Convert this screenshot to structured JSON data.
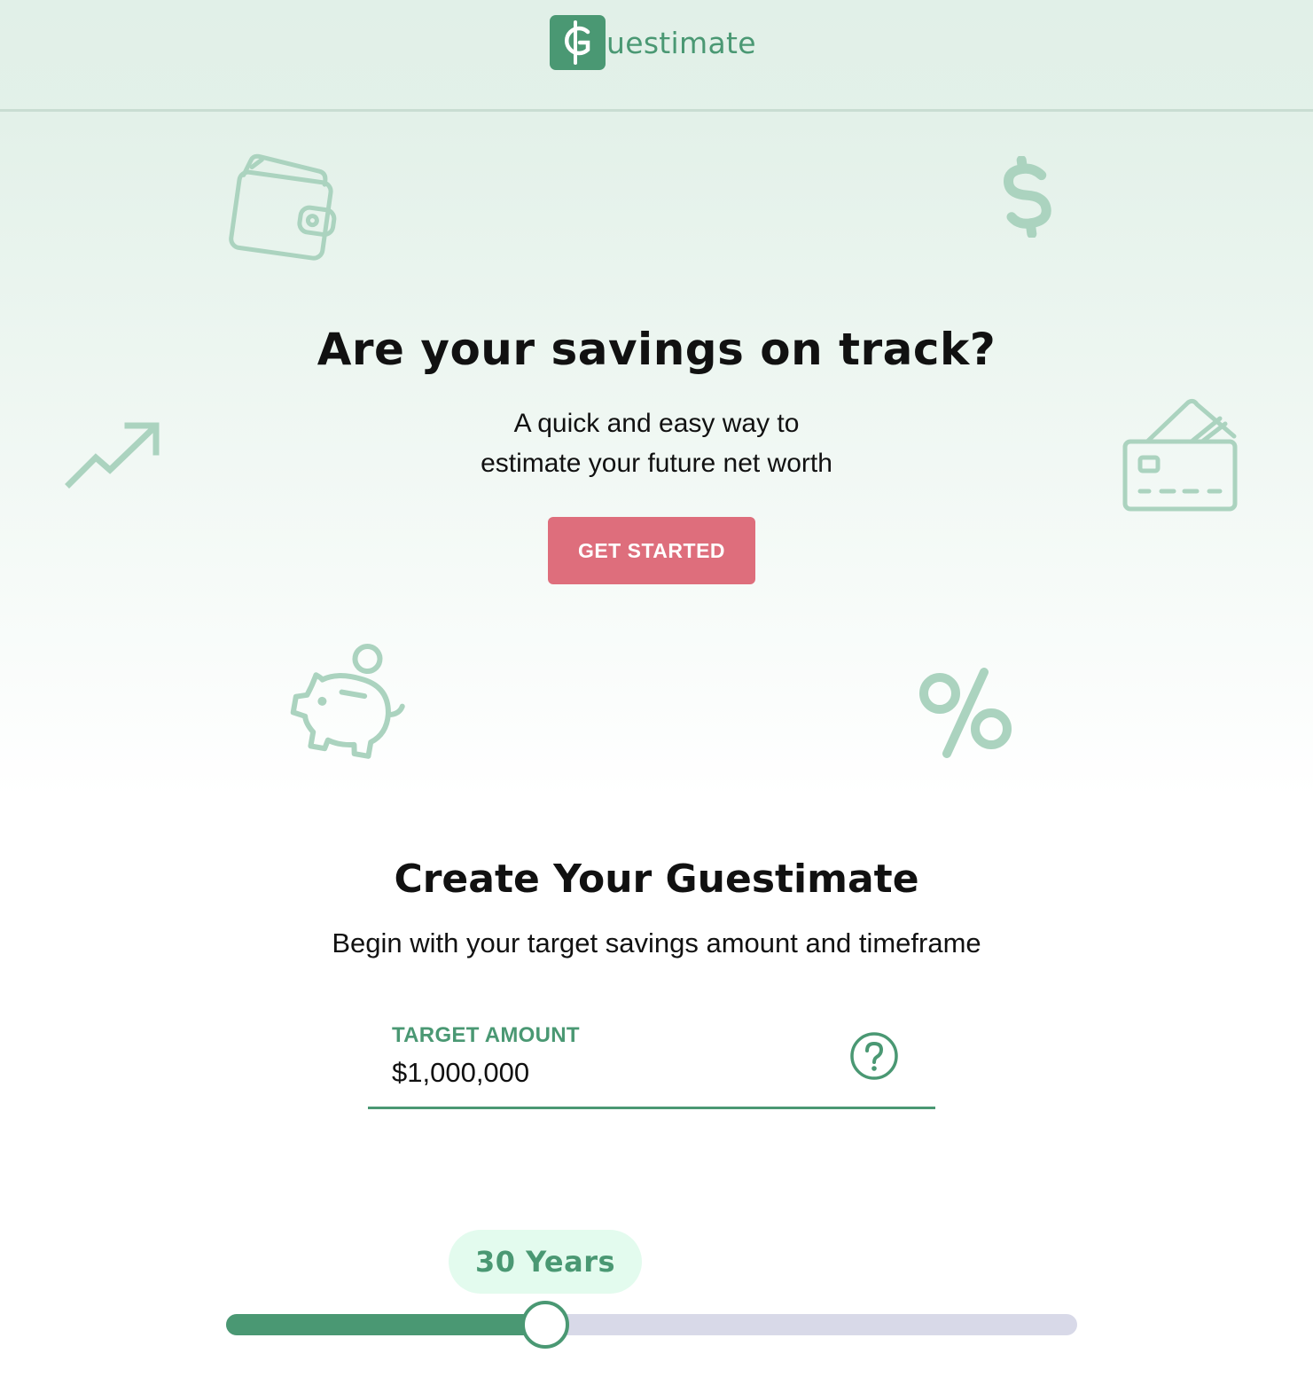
{
  "brand": {
    "logo_letter": "G",
    "name_rest": "uestimate",
    "accent_color": "#4a9873",
    "cta_color": "#de6e7c"
  },
  "icons": [
    "wallet-icon",
    "dollar-icon",
    "trending-up-icon",
    "credit-card-icon",
    "piggy-bank-icon",
    "percent-icon",
    "help-icon"
  ],
  "hero": {
    "title": "Are your savings on track?",
    "subtitle_line1": "A quick and easy way to",
    "subtitle_line2": "estimate your future net worth",
    "cta_label": "GET STARTED"
  },
  "create": {
    "title": "Create Your Guestimate",
    "subtitle": "Begin with your target savings amount and timeframe",
    "target_amount_label": "TARGET AMOUNT",
    "target_amount_value": "$1,000,000"
  },
  "timeframe": {
    "label": "30 Years",
    "slider_fraction": 0.375
  }
}
